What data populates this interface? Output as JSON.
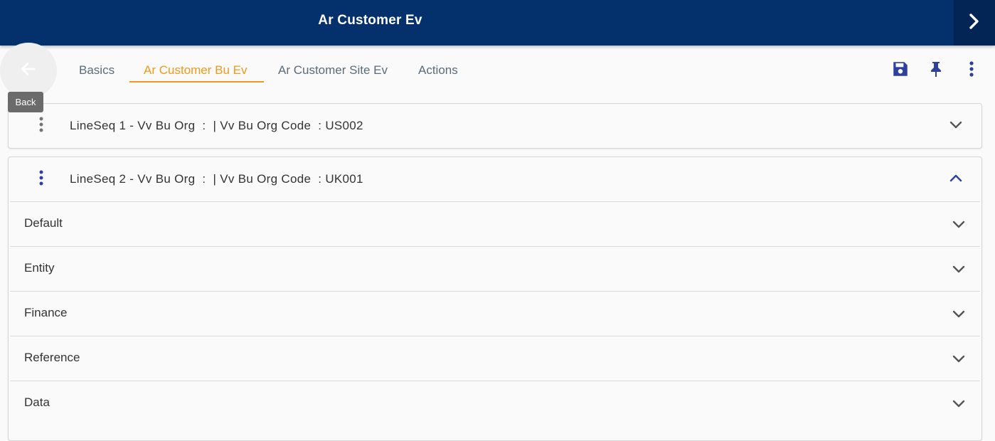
{
  "header": {
    "title": "Ar Customer Ev",
    "next_icon": "chevron-right-icon"
  },
  "back": {
    "icon": "arrow-left-icon",
    "tooltip": "Back"
  },
  "tabs": [
    {
      "label": "Basics",
      "active": false
    },
    {
      "label": "Ar Customer Bu Ev",
      "active": true
    },
    {
      "label": "Ar Customer Site Ev",
      "active": false
    },
    {
      "label": "Actions",
      "active": false
    }
  ],
  "toolbar": {
    "save_icon": "save-icon",
    "pin_icon": "pin-icon",
    "more_icon": "more-vert-icon"
  },
  "lines": [
    {
      "title": "LineSeq 1 - Vv Bu Org  :  | Vv Bu Org Code  : US002",
      "expanded": false
    },
    {
      "title": "LineSeq 2 - Vv Bu Org  :  | Vv Bu Org Code  : UK001",
      "expanded": true,
      "sections": [
        "Default",
        "Entity",
        "Finance",
        "Reference",
        "Data"
      ]
    }
  ],
  "colors": {
    "header_bg": "#04306b",
    "accent": "#f0991a",
    "icon_blue": "#2f3f9e"
  }
}
